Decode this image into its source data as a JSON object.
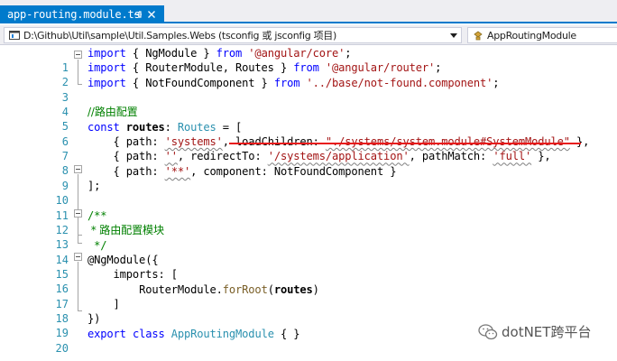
{
  "tab": {
    "title": "app-routing.module.ts",
    "pin_icon": "pin-icon",
    "close_icon": "close-icon"
  },
  "navbar": {
    "project": "D:\\Github\\Util\\sample\\Util.Samples.Webs (tsconfig 或 jsconfig 项目)",
    "symbol": "AppRoutingModule"
  },
  "code": {
    "line_numbers": [
      "1",
      "2",
      "3",
      "4",
      "5",
      "6",
      "7",
      "8",
      "9",
      "10",
      "11",
      "12",
      "13",
      "14",
      "15",
      "16",
      "17",
      "18",
      "19",
      "20"
    ],
    "l1": {
      "k1": "import",
      "t1": " { NgModule } ",
      "k2": "from",
      "s1": " '@angular/core'",
      "t2": ";"
    },
    "l2": {
      "k1": "import",
      "t1": " { RouterModule, Routes } ",
      "k2": "from",
      "s1": " '@angular/router'",
      "t2": ";"
    },
    "l3": {
      "k1": "import",
      "t1": " { NotFoundComponent } ",
      "k2": "from",
      "s1": " '../base/not-found.component'",
      "t2": ";"
    },
    "l5": {
      "c": "//路由配置"
    },
    "l6": {
      "k1": "const",
      "t1": " ",
      "v": "routes",
      "t2": ": ",
      "ty": "Routes",
      "t3": " = ["
    },
    "l7": {
      "t1": "    { ",
      "p1": "path",
      "t2": ": ",
      "s1": "'systems'",
      "t3": ", ",
      "p2": "loadChildren",
      "t4": ": ",
      "s2": "\"./systems/system.module#SystemModule\"",
      "t5": " },"
    },
    "l8": {
      "t1": "    { ",
      "p1": "path",
      "t2": ": ",
      "s1": "''",
      "t3": ", ",
      "p2": "redirectTo",
      "t4": ": ",
      "s2": "'/systems/application'",
      "t5": ", ",
      "p3": "pathMatch",
      "t6": ": ",
      "s3": "'full'",
      "t7": " },"
    },
    "l9": {
      "t1": "    { ",
      "p1": "path",
      "t2": ": ",
      "s1": "'**'",
      "t3": ", ",
      "p2": "component",
      "t4": ": ",
      "v": "NotFoundComponent",
      "t5": " }"
    },
    "l10": {
      "t1": "];"
    },
    "l12": {
      "c": "/**"
    },
    "l13": {
      "c": " * 路由配置模块"
    },
    "l14": {
      "c": " */"
    },
    "l15": {
      "t1": "@",
      "d": "NgModule",
      "t2": "({"
    },
    "l16": {
      "t1": "    ",
      "p1": "imports",
      "t2": ": ["
    },
    "l17": {
      "t1": "        ",
      "v": "RouterModule",
      "t2": ".",
      "f": "forRoot",
      "t3": "(",
      "a": "routes",
      "t4": ")"
    },
    "l18": {
      "t1": "    ]"
    },
    "l19": {
      "t1": "})"
    },
    "l20": {
      "k1": "export",
      "t1": " ",
      "k2": "class",
      "t2": " ",
      "cl": "AppRoutingModule",
      "t3": " { }"
    }
  },
  "watermark": {
    "text": "dotNET跨平台"
  }
}
